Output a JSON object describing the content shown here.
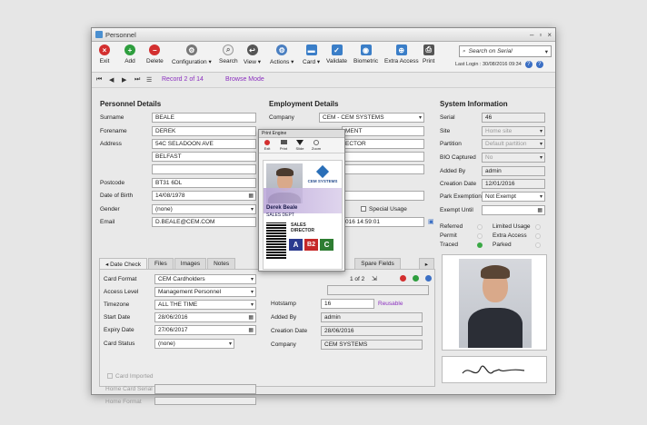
{
  "window": {
    "title": "Personnel"
  },
  "toolbar": {
    "exit": "Exit",
    "add": "Add",
    "delete": "Delete",
    "configuration": "Configuration",
    "search": "Search",
    "view": "View",
    "actions": "Actions",
    "card": "Card",
    "validate": "Validate",
    "biometric": "Biometric",
    "extra_access": "Extra Access",
    "print": "Print",
    "search_placeholder": "Search on Serial",
    "last_login": "Last Login : 30/08/2016 09:34"
  },
  "nav": {
    "record": "Record 2 of 14",
    "browse_mode": "Browse Mode"
  },
  "personnel": {
    "heading": "Personnel Details",
    "surname_label": "Surname",
    "surname": "BEALE",
    "forename_label": "Forename",
    "forename": "DEREK",
    "address_label": "Address",
    "address1": "54C SELADOON AVE",
    "address2": "BELFAST",
    "address3": "",
    "postcode_label": "Postcode",
    "postcode": "BT31 6DL",
    "dob_label": "Date of Birth",
    "dob": "14/08/1978",
    "gender_label": "Gender",
    "gender": "(none)",
    "email_label": "Email",
    "email": "D.BEALE@CEM.COM"
  },
  "employment": {
    "heading": "Employment Details",
    "company_label": "Company",
    "company": "CEM    - CEM SYSTEMS",
    "department_partial": "MENT",
    "title_partial": "ECTOR",
    "special_usage": "Special Usage",
    "date_partial": "016 14:59:01"
  },
  "system": {
    "heading": "System Information",
    "serial_label": "Serial",
    "serial": "46",
    "site_label": "Site",
    "site": "Home site",
    "partition_label": "Partition",
    "partition": "Default partition",
    "bio_label": "BIO Captured",
    "bio": "No",
    "added_by_label": "Added By",
    "added_by": "admin",
    "creation_label": "Creation Date",
    "creation": "12/01/2016",
    "park_label": "Park Exemption",
    "park": "Not Exempt",
    "exempt_label": "Exempt Until",
    "exempt": "",
    "referred": "Referred",
    "limited_usage": "Limited Usage",
    "permit": "Permit",
    "extra_access": "Extra Access",
    "traced": "Traced",
    "parked": "Parked"
  },
  "tabs": [
    "Date Check",
    "Files",
    "Images",
    "Notes",
    "Spare Fields"
  ],
  "card": {
    "format_label": "Card Format",
    "format": "CEM Cardholders",
    "access_label": "Access Level",
    "access": "Management Personnel",
    "timezone_label": "Timezone",
    "timezone": "ALL THE TIME",
    "start_label": "Start Date",
    "start": "28/06/2016",
    "expiry_label": "Expiry Date",
    "expiry": "27/06/2017",
    "status_label": "Card Status",
    "status": "(none)",
    "pager": "1 of 2",
    "hotstamp_label": "Hotstamp",
    "hotstamp": "16",
    "reusable": "Reusable",
    "added_by_label": "Added By",
    "added_by": "admin",
    "creation_label": "Creation Date",
    "creation": "28/06/2016",
    "company_label": "Company",
    "company": "CEM SYSTEMS",
    "imported": "Card Imported",
    "home_serial": "Home Card Serial",
    "home_format": "Home Format"
  },
  "print_engine": {
    "title": "Print Engine",
    "tools": [
      "Exit",
      "Print",
      "Slide",
      "Zoom"
    ],
    "name": "Derek Beale",
    "dept": "SALES DEPT",
    "logo": "CEM SYSTEMS",
    "role_line1": "SALES",
    "role_line2": "DIRECTOR",
    "badges": [
      "A",
      "B2",
      "C"
    ],
    "badge_colors": [
      "#2b3a8f",
      "#c62828",
      "#2e7d32"
    ]
  }
}
